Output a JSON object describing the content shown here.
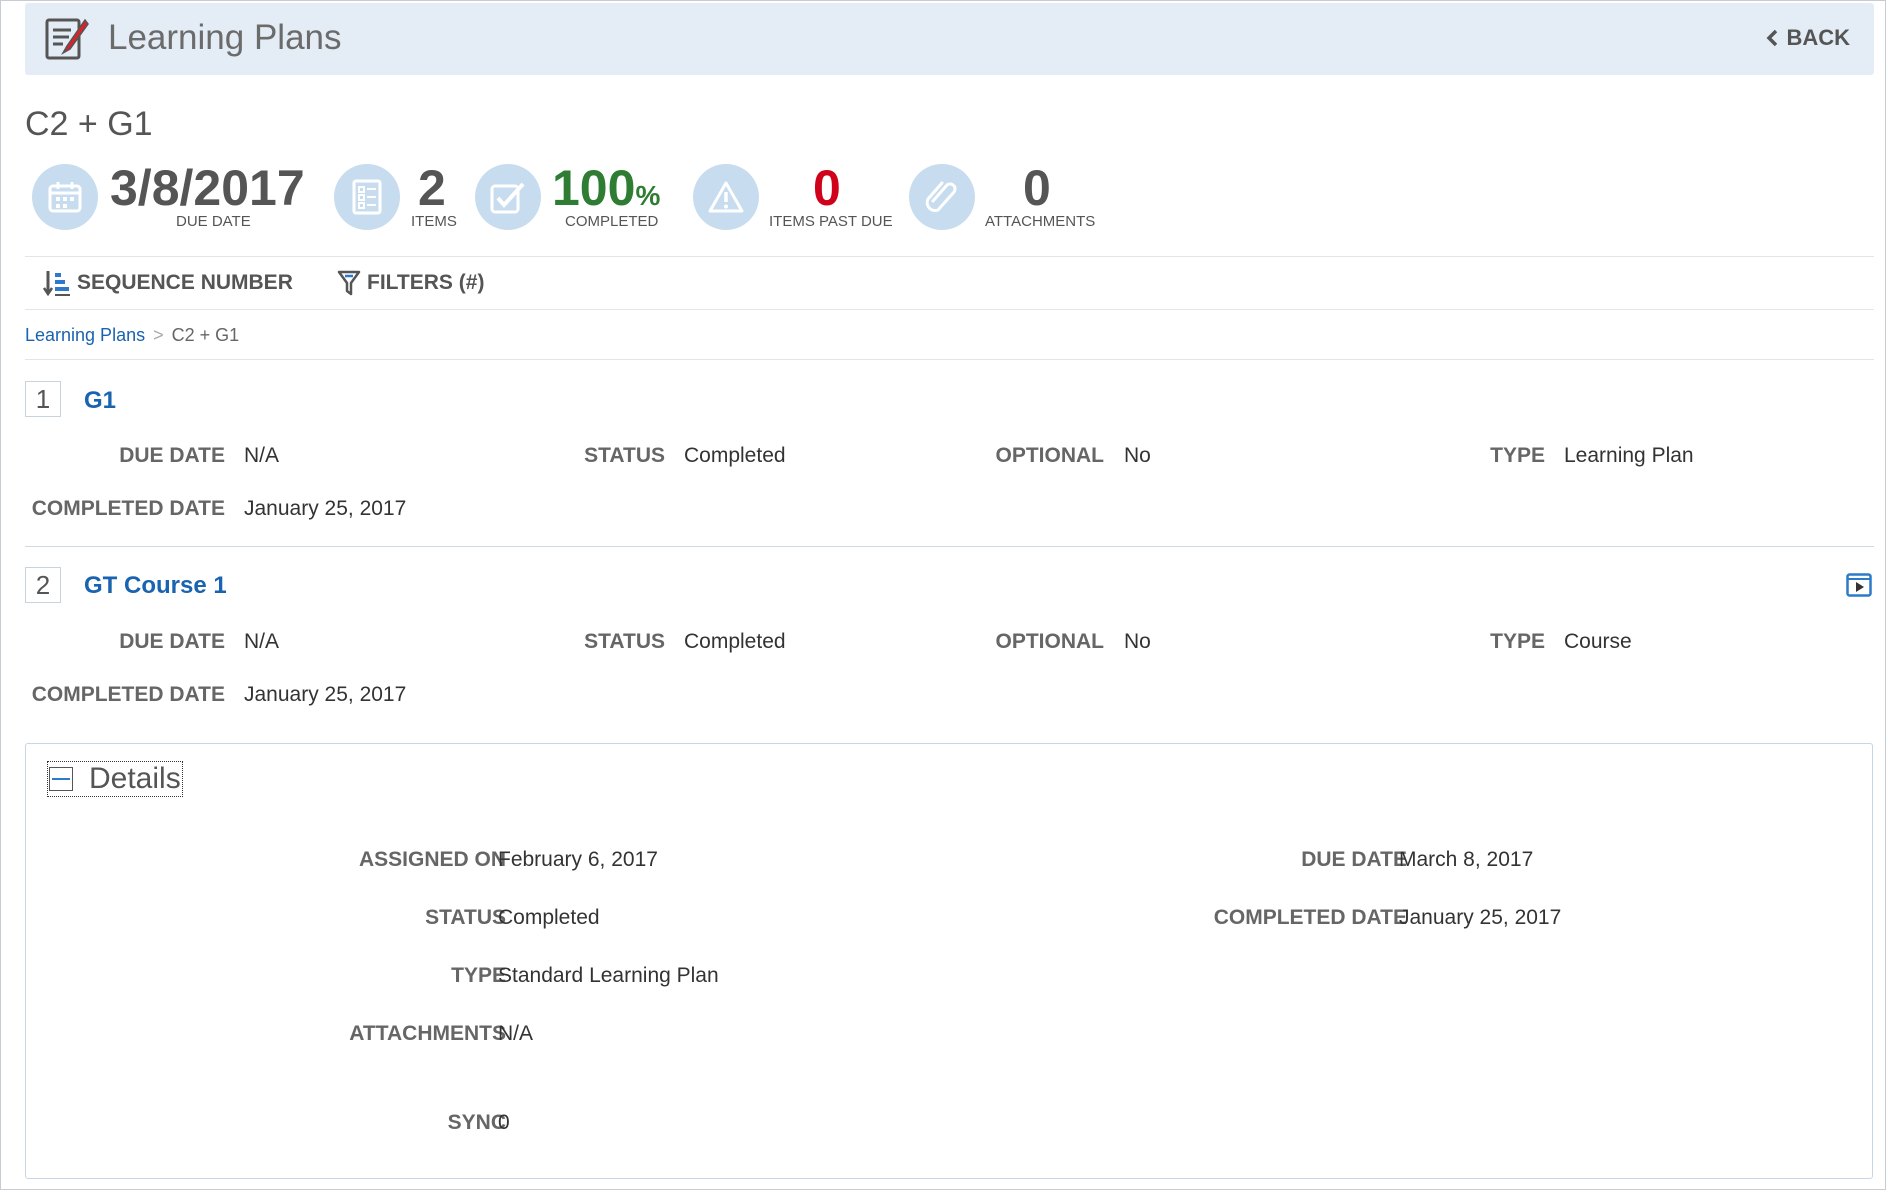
{
  "header": {
    "title": "Learning Plans",
    "back_label": "BACK"
  },
  "plan": {
    "title": "C2 + G1"
  },
  "stats": {
    "due_date": {
      "value": "3/8/2017",
      "label": "DUE DATE"
    },
    "items": {
      "value": "2",
      "label": "ITEMS"
    },
    "completed": {
      "value": "100",
      "unit": "%",
      "label": "COMPLETED"
    },
    "past_due": {
      "value": "0",
      "label": "ITEMS PAST DUE"
    },
    "attachments": {
      "value": "0",
      "label": "ATTACHMENTS"
    }
  },
  "toolbar": {
    "sort_label": "SEQUENCE NUMBER",
    "filter_label": "FILTERS (#)"
  },
  "breadcrumb": {
    "root": "Learning Plans",
    "sep": ">",
    "current": "C2 + G1"
  },
  "items": [
    {
      "number": "1",
      "title": "G1",
      "due_date_label": "DUE DATE",
      "due_date": "N/A",
      "status_label": "STATUS",
      "status": "Completed",
      "optional_label": "OPTIONAL",
      "optional": "No",
      "type_label": "TYPE",
      "type": "Learning Plan",
      "completed_label": "COMPLETED DATE",
      "completed_date": "January 25, 2017"
    },
    {
      "number": "2",
      "title": "GT Course 1",
      "due_date_label": "DUE DATE",
      "due_date": "N/A",
      "status_label": "STATUS",
      "status": "Completed",
      "optional_label": "OPTIONAL",
      "optional": "No",
      "type_label": "TYPE",
      "type": "Course",
      "completed_label": "COMPLETED DATE",
      "completed_date": "January 25, 2017"
    }
  ],
  "details": {
    "toggle_label": "Details",
    "assigned_on_label": "ASSIGNED ON",
    "assigned_on": "February 6, 2017",
    "status_label": "STATUS",
    "status": "Completed",
    "type_label": "TYPE",
    "type": "Standard Learning Plan",
    "attachments_label": "ATTACHMENTS",
    "attachments": "N/A",
    "sync_label": "SYNC",
    "sync": "0",
    "due_date_label": "DUE DATE",
    "due_date": "March 8, 2017",
    "completed_label": "COMPLETED DATE",
    "completed_date": "January 25, 2017"
  },
  "colors": {
    "accent": "#1a63b0",
    "success": "#2e7d32",
    "danger": "#d0021b",
    "header_bg": "#e4edf6",
    "icon_bg": "#c7dcef"
  },
  "icons": [
    "edit-document-icon",
    "chevron-left-icon",
    "calendar-icon",
    "list-icon",
    "checkbox-icon",
    "warning-icon",
    "paperclip-icon",
    "sort-icon",
    "filter-icon",
    "launch-icon",
    "collapse-icon"
  ]
}
